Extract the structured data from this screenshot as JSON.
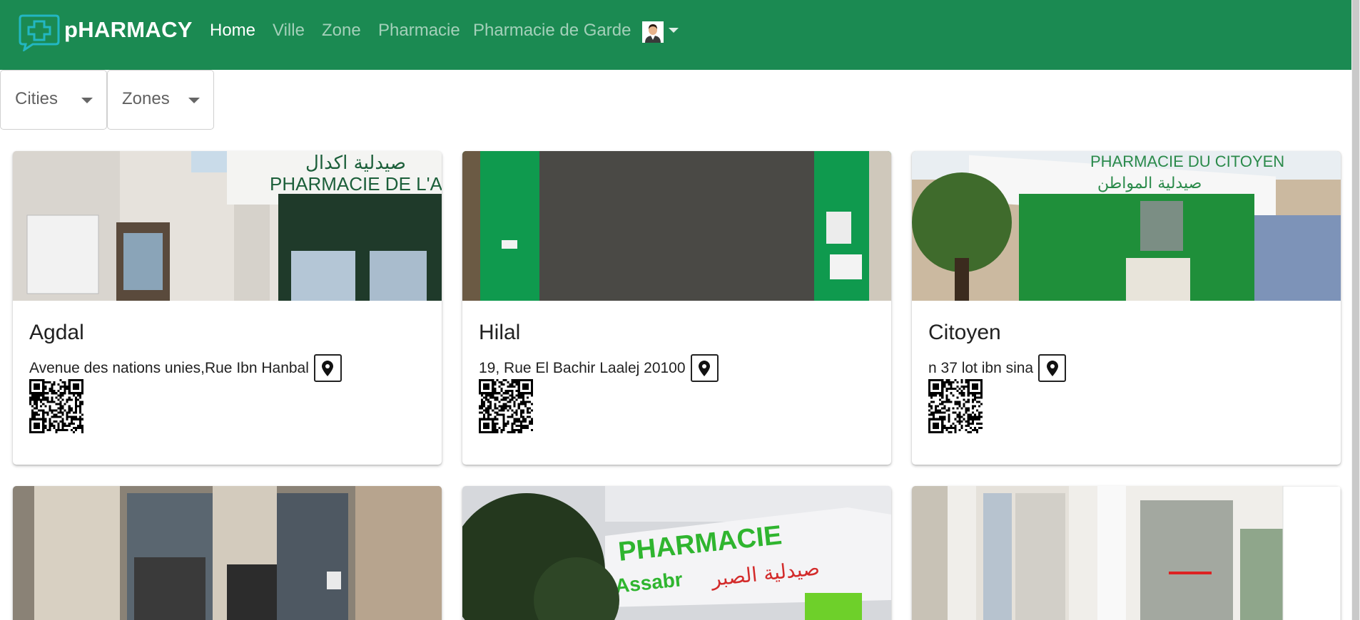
{
  "brand": {
    "name": "pHARMACY"
  },
  "nav": {
    "home": "Home",
    "ville": "Ville",
    "zone": "Zone",
    "pharmacie": "Pharmacie",
    "garde": "Pharmacie de Garde"
  },
  "filters": {
    "cities": "Cities",
    "zones": "Zones"
  },
  "pharmacies": [
    {
      "name": "Agdal",
      "address": "Avenue des nations unies,Rue Ibn Hanbal",
      "photo_sign": "PHARMACIE DE L'AGDAL",
      "photo_sign_ar": "صيدلية اكدال"
    },
    {
      "name": "Hilal",
      "address": "19, Rue El Bachir Laalej 20100"
    },
    {
      "name": "Citoyen",
      "address": "n 37 lot ibn sina",
      "photo_sign": "PHARMACIE DU CITOYEN",
      "photo_sign_ar": "صيدلية المواطن"
    },
    {
      "name": "",
      "address": ""
    },
    {
      "name": "",
      "address": "",
      "photo_sign": "PHARMACIE",
      "photo_sign_2": "Assabr",
      "photo_sign_ar": "صيدلية الصبر"
    },
    {
      "name": "",
      "address": ""
    }
  ],
  "colors": {
    "navbar": "#1b8a52",
    "pharmacy_green": "#0f9a4e",
    "text": "#212121"
  },
  "icons": {
    "brand": "pharmacy-cross-chat-icon",
    "location": "map-pin-icon",
    "user": "user-avatar-icon"
  }
}
